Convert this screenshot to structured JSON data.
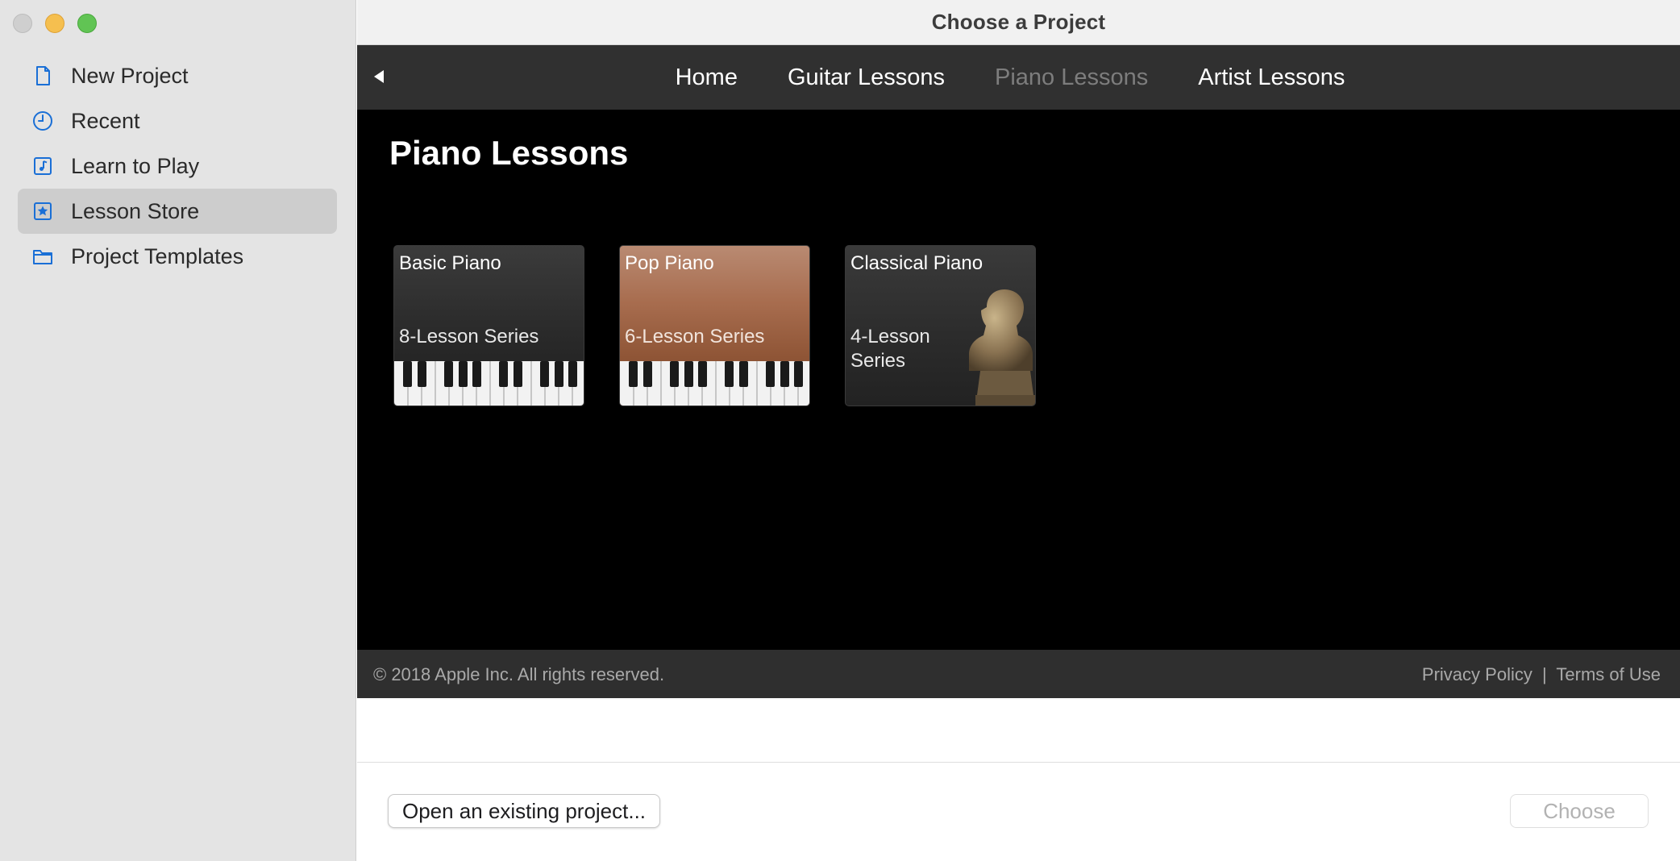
{
  "window": {
    "title": "Choose a Project"
  },
  "sidebar": {
    "items": [
      {
        "label": "New Project",
        "icon": "document-icon"
      },
      {
        "label": "Recent",
        "icon": "clock-icon"
      },
      {
        "label": "Learn to Play",
        "icon": "music-note-icon"
      },
      {
        "label": "Lesson Store",
        "icon": "star-icon",
        "selected": true
      },
      {
        "label": "Project Templates",
        "icon": "folder-icon"
      }
    ],
    "accent_color": "#1a6fd6"
  },
  "store": {
    "nav": {
      "tabs": [
        {
          "label": "Home"
        },
        {
          "label": "Guitar Lessons"
        },
        {
          "label": "Piano Lessons",
          "active": true
        },
        {
          "label": "Artist Lessons"
        }
      ]
    },
    "heading": "Piano Lessons",
    "cards": [
      {
        "title": "Basic Piano",
        "subtitle": "8-Lesson Series"
      },
      {
        "title": "Pop Piano",
        "subtitle": "6-Lesson Series"
      },
      {
        "title": "Classical Piano",
        "subtitle": "4-Lesson Series"
      }
    ],
    "footer": {
      "copyright": "© 2018 Apple Inc. All rights reserved.",
      "privacy": "Privacy Policy",
      "separator": "|",
      "terms": "Terms of Use"
    }
  },
  "actions": {
    "open_label": "Open an existing project...",
    "choose_label": "Choose"
  }
}
